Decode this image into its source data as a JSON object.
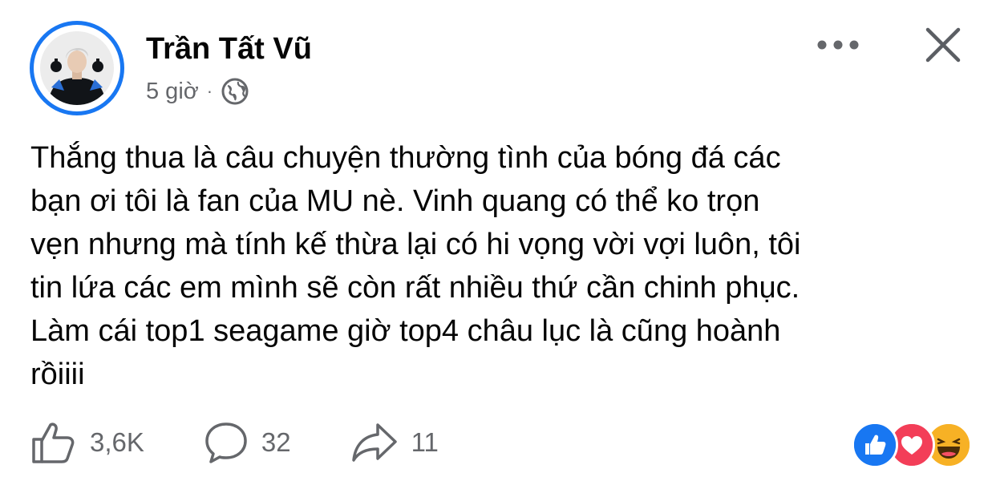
{
  "author": {
    "name": "Trần Tất Vũ",
    "time": "5 giờ",
    "separator": "·",
    "audience_icon": "globe-icon"
  },
  "header": {
    "more_icon": "more-horizontal-icon",
    "close_icon": "close-icon"
  },
  "post": {
    "text": "Thắng thua là câu chuyện thường tình của bóng đá các\nbạn ơi tôi là fan của MU nè. Vinh quang có thể ko trọn\nvẹn nhưng mà tính kế thừa lại có hi vọng vời vợi luôn, tôi\ntin lứa các em mình sẽ còn rất nhiều thứ cần chinh phục.\nLàm cái top1 seagame giờ top4 châu lục là cũng hoành\nrồiiii"
  },
  "actions": {
    "like_count": "3,6K",
    "comment_count": "32",
    "share_count": "11"
  },
  "reactions": [
    "like-icon",
    "love-icon",
    "haha-icon"
  ],
  "colors": {
    "brand_blue": "#1877f2",
    "love_red": "#f33e58",
    "haha_yellow": "#f7b125",
    "secondary_text": "#65676b"
  }
}
